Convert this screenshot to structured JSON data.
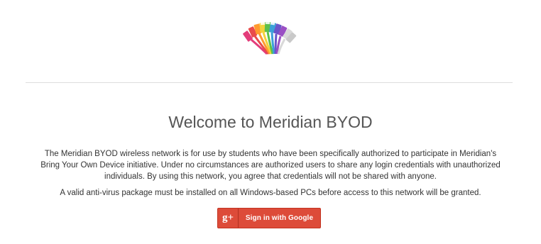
{
  "header": {
    "logo_icon": "ethernet-cables-logo"
  },
  "main": {
    "title": "Welcome to Meridian BYOD",
    "paragraphs": [
      "The Meridian BYOD wireless network is for use by students who have been specifically authorized to participate in Meridian's Bring Your Own Device initiative. Under no circumstances are authorized users to share any login credentials with unauthorized individuals. By using this network, you agree that credentials will not be shared with anyone.",
      "A valid anti-virus package must be installed on all Windows-based PCs before access to this network will be granted."
    ],
    "google_button": {
      "icon_text": "g+",
      "label": "Sign in with Google"
    }
  },
  "colors": {
    "google_red": "#dd4b39",
    "divider": "#dddddd",
    "title": "#555555"
  }
}
